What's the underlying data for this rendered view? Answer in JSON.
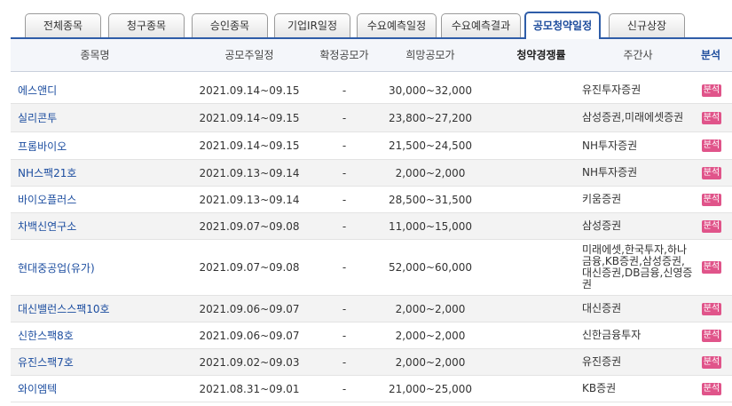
{
  "tabs": [
    {
      "label": "전체종목",
      "active": false
    },
    {
      "label": "청구종목",
      "active": false
    },
    {
      "label": "승인종목",
      "active": false
    },
    {
      "label": "기업IR일정",
      "active": false
    },
    {
      "label": "수요예측일정",
      "active": false
    },
    {
      "label": "수요예측결과",
      "active": false
    },
    {
      "label": "공모청약일정",
      "active": true
    },
    {
      "label": "신규상장",
      "active": false
    }
  ],
  "table": {
    "headers": {
      "name": "종목명",
      "date": "공모주일정",
      "confirmed": "확정공모가",
      "hoped": "희망공모가",
      "competition": "청약경쟁률",
      "manager": "주간사",
      "analysis": "분석"
    },
    "rows": [
      {
        "name": "에스앤디",
        "date": "2021.09.14~09.15",
        "confirmed": "-",
        "hoped": "30,000~32,000",
        "competition": "",
        "manager": "유진투자증권",
        "analysis": "분석"
      },
      {
        "name": "실리콘투",
        "date": "2021.09.14~09.15",
        "confirmed": "-",
        "hoped": "23,800~27,200",
        "competition": "",
        "manager": "삼성증권,미래에셋증권",
        "analysis": "분석"
      },
      {
        "name": "프롬바이오",
        "date": "2021.09.14~09.15",
        "confirmed": "-",
        "hoped": "21,500~24,500",
        "competition": "",
        "manager": "NH투자증권",
        "analysis": "분석"
      },
      {
        "name": "NH스팩21호",
        "date": "2021.09.13~09.14",
        "confirmed": "-",
        "hoped": "2,000~2,000",
        "competition": "",
        "manager": "NH투자증권",
        "analysis": "분석"
      },
      {
        "name": "바이오플러스",
        "date": "2021.09.13~09.14",
        "confirmed": "-",
        "hoped": "28,500~31,500",
        "competition": "",
        "manager": "키움증권",
        "analysis": "분석"
      },
      {
        "name": "차백신연구소",
        "date": "2021.09.07~09.08",
        "confirmed": "-",
        "hoped": "11,000~15,000",
        "competition": "",
        "manager": "삼성증권",
        "analysis": "분석"
      },
      {
        "name": "현대중공업(유가)",
        "date": "2021.09.07~09.08",
        "confirmed": "-",
        "hoped": "52,000~60,000",
        "competition": "",
        "manager": "미래에셋,한국투자,하나금융,KB증권,삼성증권,대신증권,DB금융,신영증권",
        "analysis": "분석"
      },
      {
        "name": "대신밸런스스팩10호",
        "date": "2021.09.06~09.07",
        "confirmed": "-",
        "hoped": "2,000~2,000",
        "competition": "",
        "manager": "대신증권",
        "analysis": "분석"
      },
      {
        "name": "신한스팩8호",
        "date": "2021.09.06~09.07",
        "confirmed": "-",
        "hoped": "2,000~2,000",
        "competition": "",
        "manager": "신한금융투자",
        "analysis": "분석"
      },
      {
        "name": "유진스팩7호",
        "date": "2021.09.02~09.03",
        "confirmed": "-",
        "hoped": "2,000~2,000",
        "competition": "",
        "manager": "유진증권",
        "analysis": "분석"
      },
      {
        "name": "와이엠텍",
        "date": "2021.08.31~09.01",
        "confirmed": "-",
        "hoped": "21,000~25,000",
        "competition": "",
        "manager": "KB증권",
        "analysis": "분석"
      }
    ]
  }
}
